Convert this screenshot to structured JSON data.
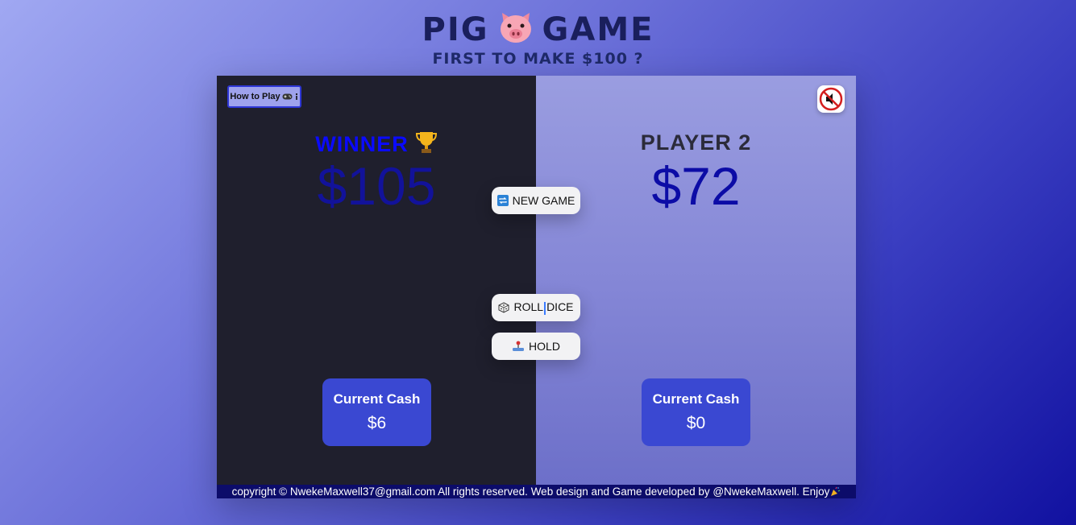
{
  "header": {
    "title_left": "PIG",
    "title_right": "GAME",
    "title_icon": "pig-face-icon",
    "subtitle": "FIRST TO MAKE $100 ?"
  },
  "controls": {
    "how_to_play_label": "How to Play",
    "how_to_play_icons": [
      "gamepad-icon",
      "info-icon"
    ],
    "mute_icon": "muted-speaker-icon"
  },
  "player1": {
    "name": "WINNER",
    "status_icon": "trophy-icon",
    "score": "$105",
    "current_label": "Current Cash",
    "current_value": "$6",
    "active": true
  },
  "player2": {
    "name": "PLAYER 2",
    "score": "$72",
    "current_label": "Current Cash",
    "current_value": "$0",
    "active": false
  },
  "buttons": {
    "new_game": {
      "label": "NEW GAME",
      "icon": "repeat-icon"
    },
    "roll_dice_part1": "ROLL",
    "roll_dice_part2": "DICE",
    "roll_dice_icon": "dice-icon",
    "hold": {
      "label": "HOLD",
      "icon": "joystick-icon"
    }
  },
  "footer": {
    "text": "copyright © NwekeMaxwell37@gmail.com All rights reserved. Web design and Game developed by @NwekeMaxwell. Enjoy",
    "icon": "party-popper-icon"
  },
  "colors": {
    "accent": "#3a48d2",
    "left_panel": "#1f1f2d",
    "winner_text": "#0a0aff",
    "footer_bg": "#0c0c6a"
  }
}
